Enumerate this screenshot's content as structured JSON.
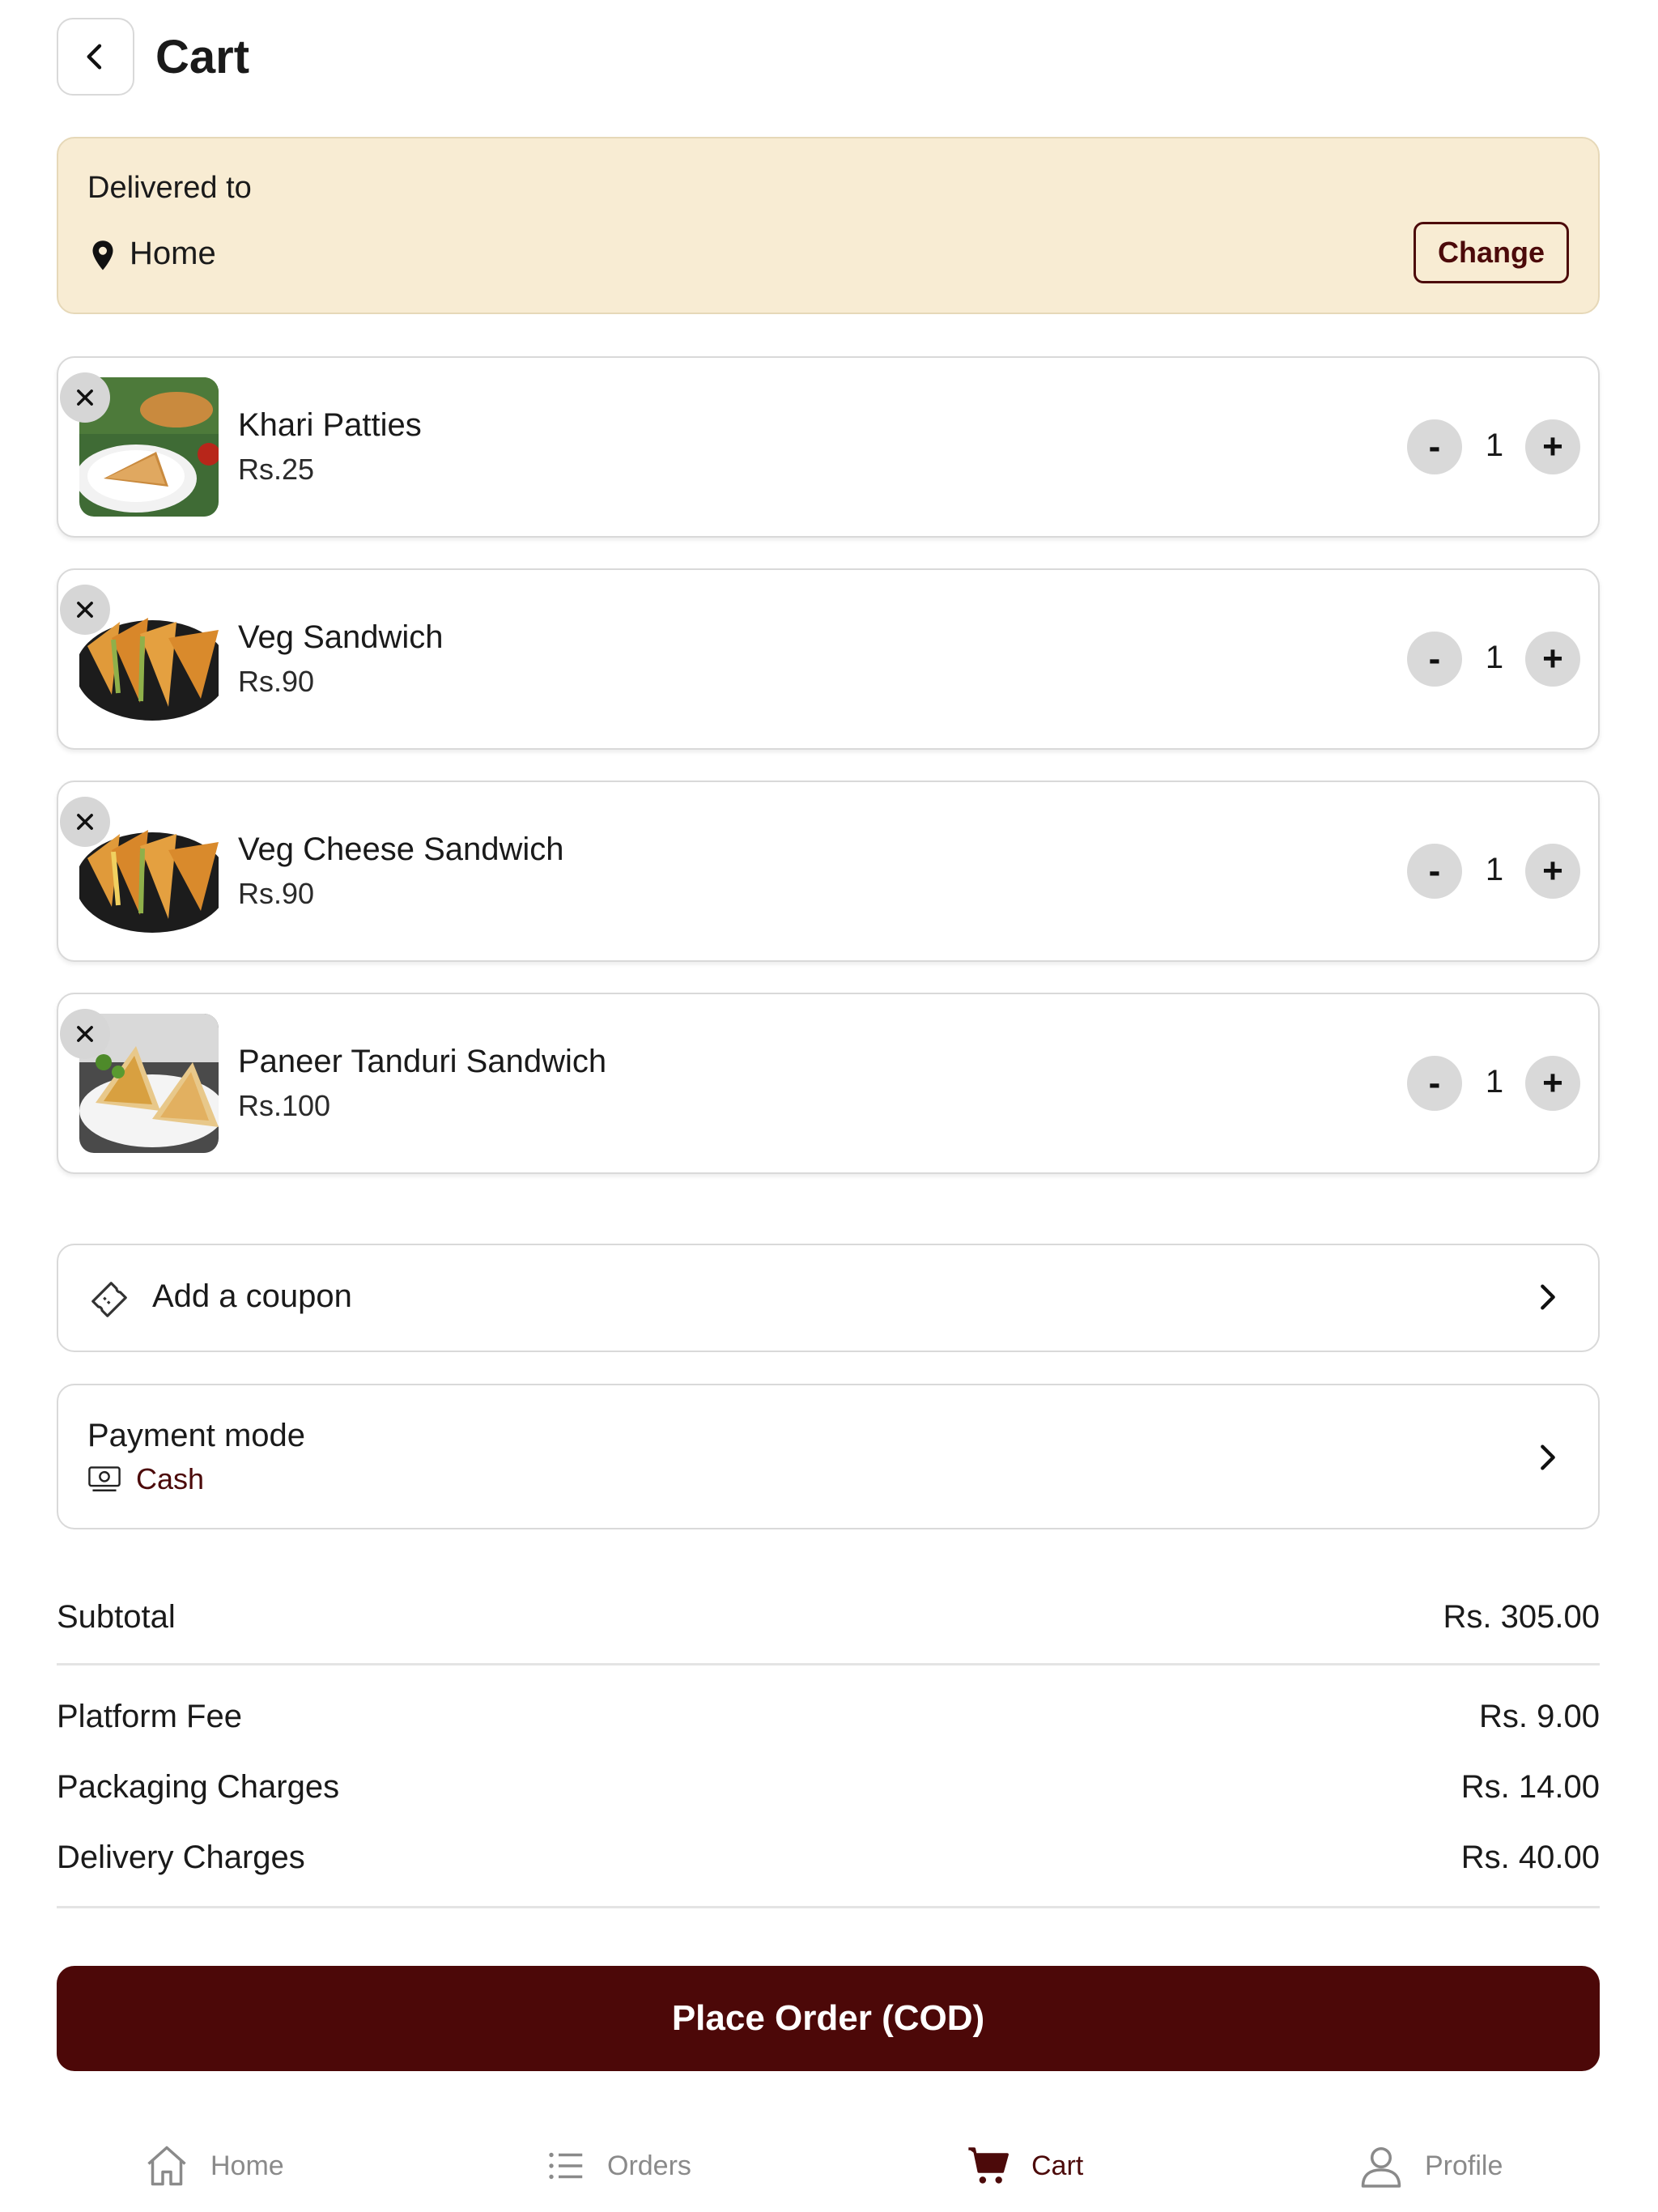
{
  "header": {
    "title": "Cart"
  },
  "delivery": {
    "label": "Delivered to",
    "location": "Home",
    "change_label": "Change"
  },
  "items": [
    {
      "name": "Khari Patties",
      "price": "Rs.25",
      "qty": "1",
      "minus": "-",
      "plus": "+"
    },
    {
      "name": "Veg Sandwich",
      "price": "Rs.90",
      "qty": "1",
      "minus": "-",
      "plus": "+"
    },
    {
      "name": "Veg Cheese Sandwich",
      "price": "Rs.90",
      "qty": "1",
      "minus": "-",
      "plus": "+"
    },
    {
      "name": "Paneer Tanduri Sandwich",
      "price": "Rs.100",
      "qty": "1",
      "minus": "-",
      "plus": "+"
    }
  ],
  "coupon": {
    "label": "Add a coupon"
  },
  "payment": {
    "title": "Payment mode",
    "mode": "Cash"
  },
  "summary": {
    "subtotal_label": "Subtotal",
    "subtotal": "Rs. 305.00",
    "platform_label": "Platform Fee",
    "platform": "Rs. 9.00",
    "packaging_label": "Packaging Charges",
    "packaging": "Rs. 14.00",
    "delivery_label": "Delivery Charges",
    "delivery": "Rs. 40.00"
  },
  "place_order": {
    "label": "Place Order (COD)"
  },
  "nav": [
    {
      "label": "Home",
      "icon": "home-icon"
    },
    {
      "label": "Orders",
      "icon": "list-icon"
    },
    {
      "label": "Cart",
      "icon": "cart-icon",
      "active": true
    },
    {
      "label": "Profile",
      "icon": "user-icon"
    }
  ],
  "colors": {
    "brand": "#4c0808",
    "delivery_bg": "#f8ecd3",
    "muted": "#8a8a8a"
  }
}
